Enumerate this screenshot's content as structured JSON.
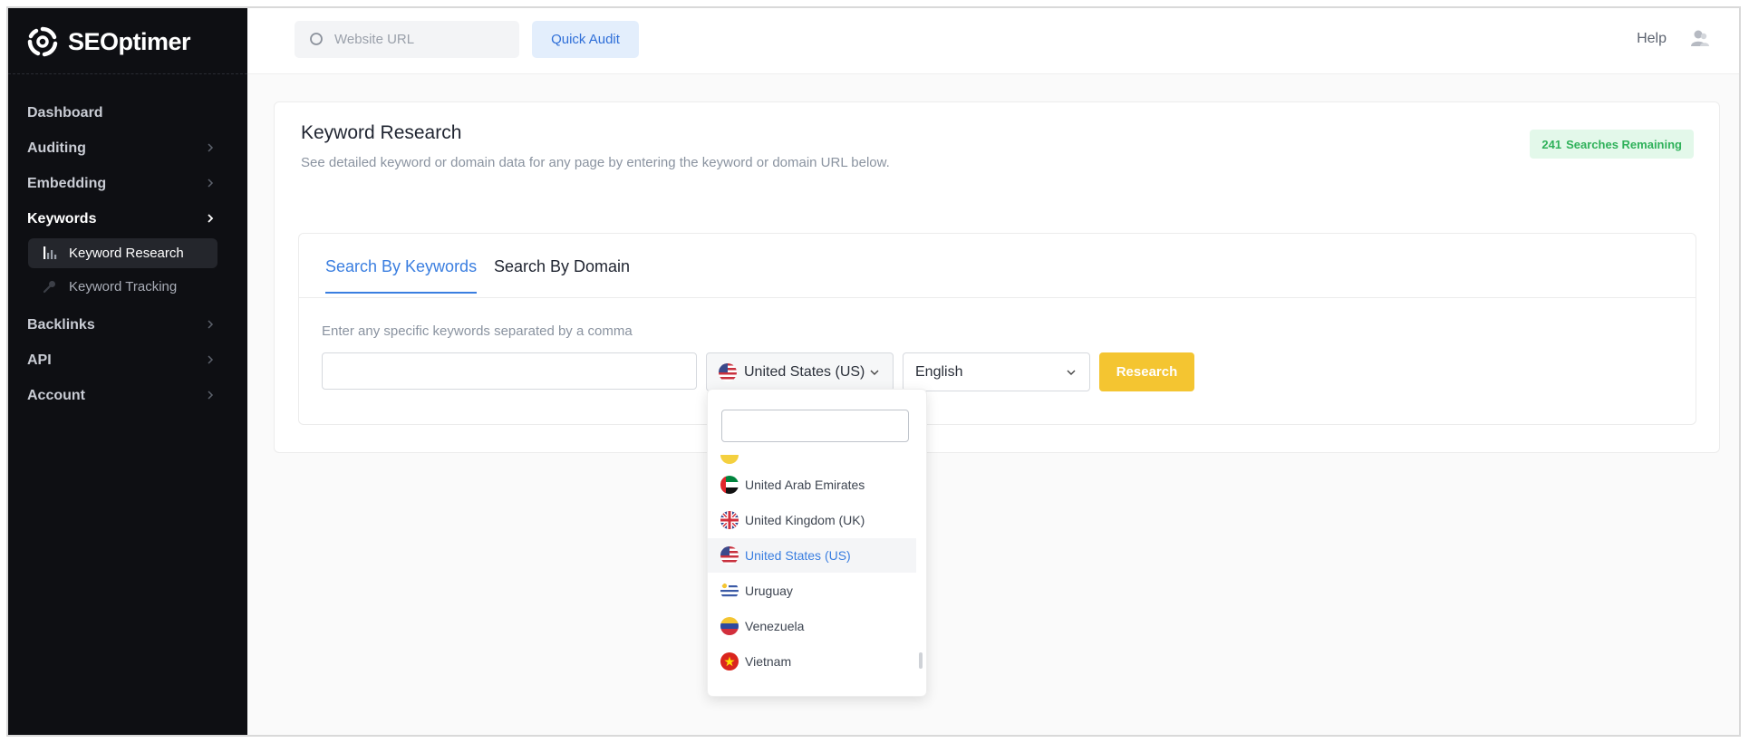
{
  "sidebar": {
    "brand": "SEOptimer",
    "items": [
      {
        "label": "Dashboard",
        "has_chevron": false
      },
      {
        "label": "Auditing",
        "has_chevron": true
      },
      {
        "label": "Embedding",
        "has_chevron": true
      },
      {
        "label": "Keywords",
        "has_chevron": true,
        "active": true
      },
      {
        "label": "Backlinks",
        "has_chevron": true
      },
      {
        "label": "API",
        "has_chevron": true
      },
      {
        "label": "Account",
        "has_chevron": true
      }
    ],
    "keywords_sub": [
      {
        "label": "Keyword Research",
        "icon": "bar-chart-icon",
        "active": true
      },
      {
        "label": "Keyword Tracking",
        "icon": "key-icon",
        "active": false
      }
    ]
  },
  "topbar": {
    "url_placeholder": "Website URL",
    "quick_audit_label": "Quick Audit",
    "help_label": "Help"
  },
  "main": {
    "title": "Keyword Research",
    "subtitle": "See detailed keyword or domain data for any page by entering the keyword or domain URL below.",
    "searches_remaining_count": "241",
    "searches_remaining_label": "Searches Remaining",
    "tabs": [
      {
        "label": "Search By Keywords",
        "active": true
      },
      {
        "label": "Search By Domain",
        "active": false
      }
    ],
    "hint": "Enter any specific keywords separated by a comma",
    "country_selected": "United States (US)",
    "language_selected": "English",
    "research_label": "Research"
  },
  "dropdown": {
    "search_value": "",
    "options": [
      {
        "label": "United Arab Emirates",
        "flag": "ae",
        "selected": false
      },
      {
        "label": "United Kingdom (UK)",
        "flag": "gb",
        "selected": false
      },
      {
        "label": "United States (US)",
        "flag": "us",
        "selected": true
      },
      {
        "label": "Uruguay",
        "flag": "uy",
        "selected": false
      },
      {
        "label": "Venezuela",
        "flag": "ve",
        "selected": false
      },
      {
        "label": "Vietnam",
        "flag": "vn",
        "selected": false
      }
    ]
  },
  "colors": {
    "sidebar_bg": "#0e0f13",
    "accent_blue": "#3a7ee0",
    "research_yellow": "#f4c531",
    "badge_green": "#2fb15a"
  }
}
